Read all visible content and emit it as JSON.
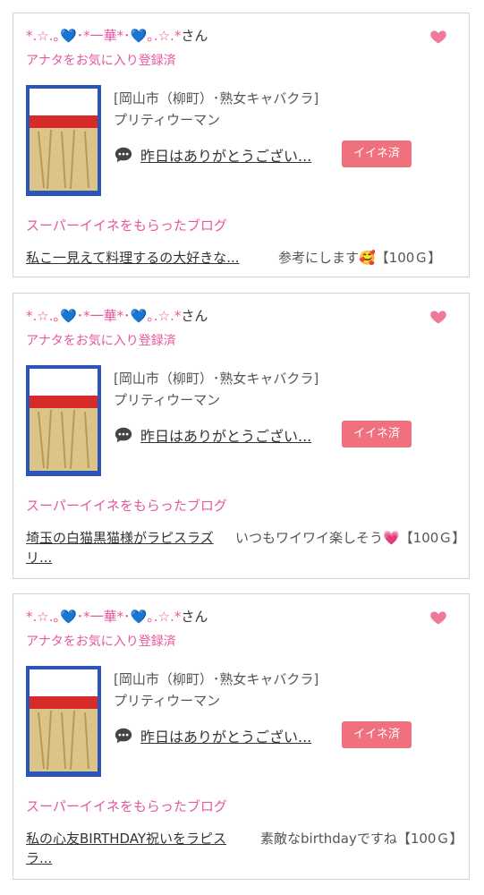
{
  "colors": {
    "pink_text": "#e6579f",
    "button_bg": "#f0707e",
    "border": "#d2d2d2"
  },
  "icons": {
    "heart": "heart-icon",
    "comment": "speech-bubble-icon"
  },
  "cards": [
    {
      "user_name": "*.☆.｡💙･*一華*･💙｡.☆.*",
      "user_suffix": "さん",
      "favorite_status": "アナタをお気に入り登録済",
      "shop_area": "[岡山市（柳町）･熟女キャバクラ]",
      "shop_name": "プリティウーマン",
      "comment": "昨日はありがとうござい...",
      "like_button": "イイネ済",
      "super_label": "スーパーイイネをもらったブログ",
      "blog_title": "私こ一見えて料理するの大好きな...",
      "blog_note": "参考にします🥰【100Ｇ】"
    },
    {
      "user_name": "*.☆.｡💙･*一華*･💙｡.☆.*",
      "user_suffix": "さん",
      "favorite_status": "アナタをお気に入り登録済",
      "shop_area": "[岡山市（柳町）･熟女キャバクラ]",
      "shop_name": "プリティウーマン",
      "comment": "昨日はありがとうござい...",
      "like_button": "イイネ済",
      "super_label": "スーパーイイネをもらったブログ",
      "blog_title": "埼玉の白猫黒猫様がラピスラズリ...",
      "blog_note": "いつもワイワイ楽しそう💗【100Ｇ】"
    },
    {
      "user_name": "*.☆.｡💙･*一華*･💙｡.☆.*",
      "user_suffix": "さん",
      "favorite_status": "アナタをお気に入り登録済",
      "shop_area": "[岡山市（柳町）･熟女キャバクラ]",
      "shop_name": "プリティウーマン",
      "comment": "昨日はありがとうござい...",
      "like_button": "イイネ済",
      "super_label": "スーパーイイネをもらったブログ",
      "blog_title": "私の心友BIRTHDAY祝いをラピスラ...",
      "blog_note": "素敵なbirthdayですね【100Ｇ】"
    }
  ]
}
